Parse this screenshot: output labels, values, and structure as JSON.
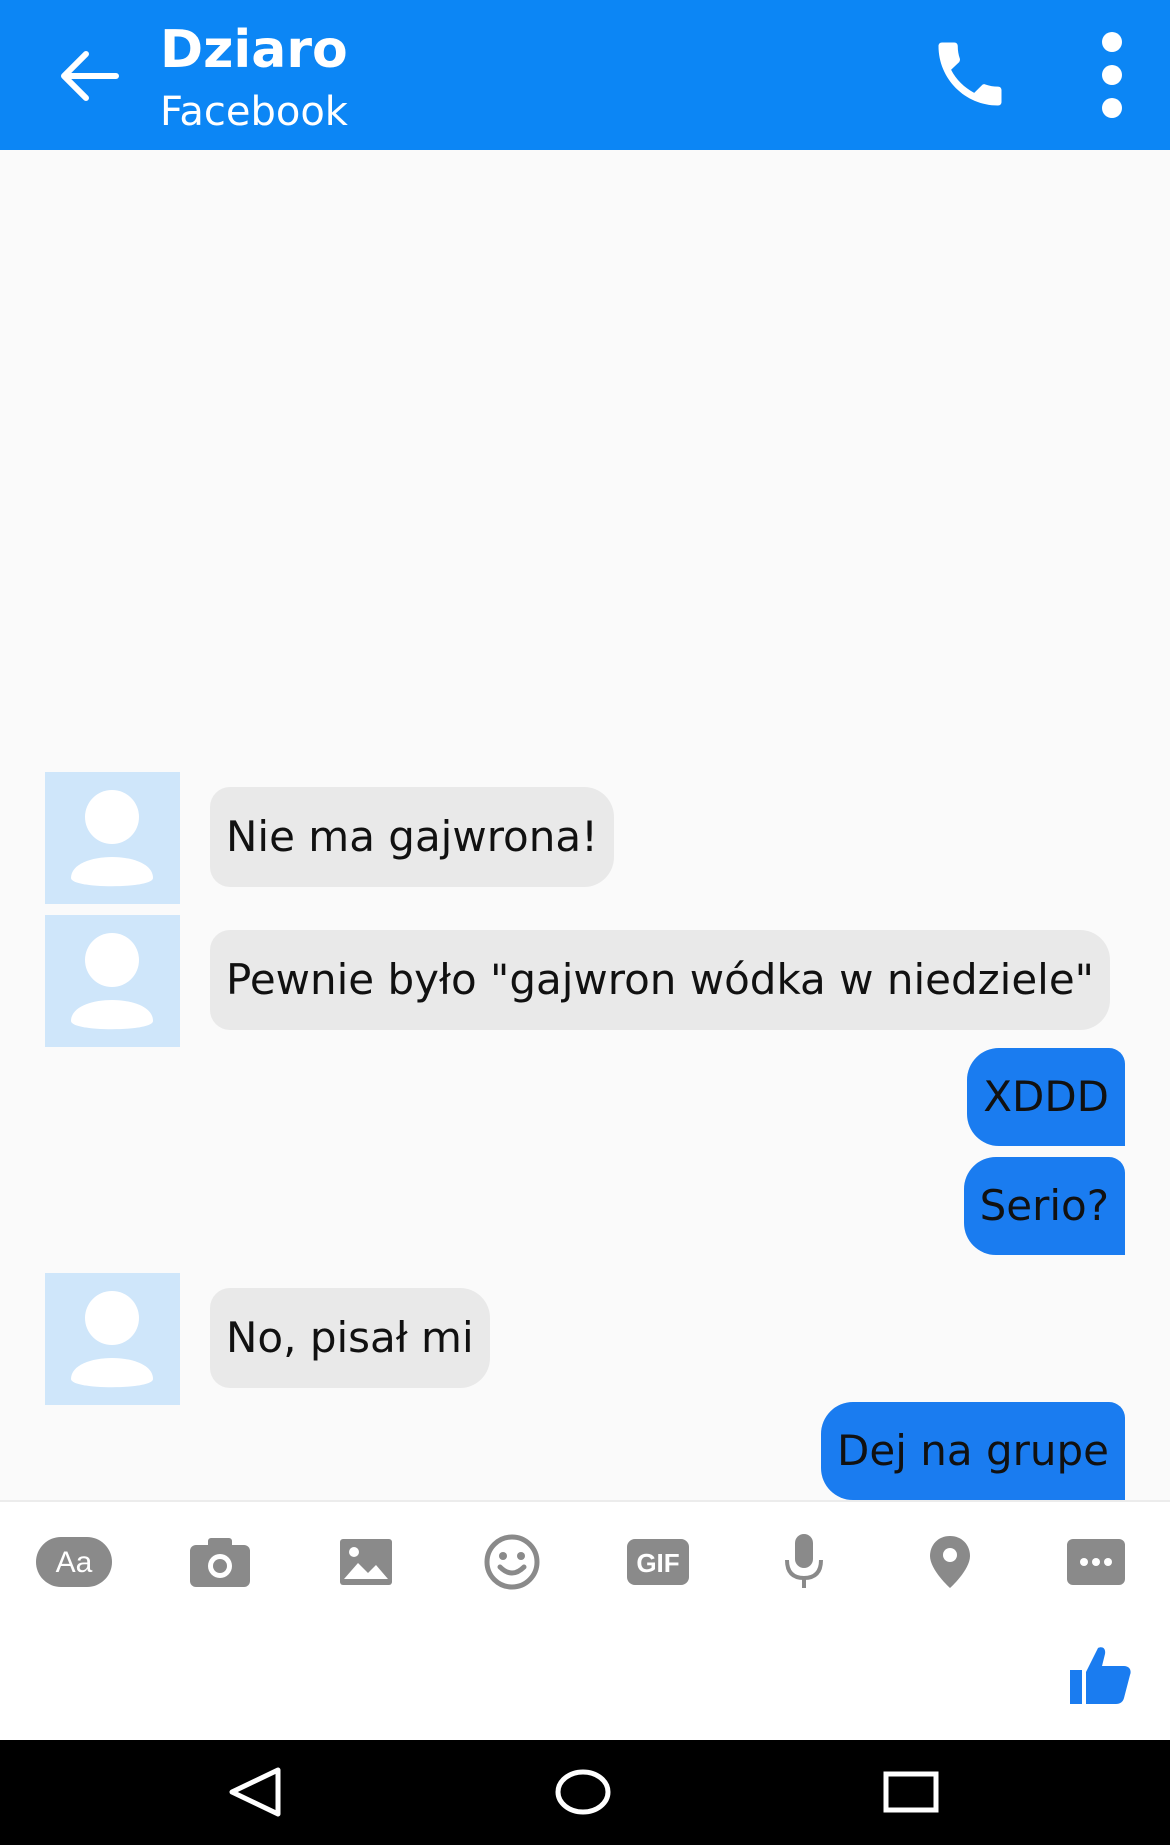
{
  "header": {
    "contact_name": "Dziaro",
    "subtitle": "Facebook",
    "icons": [
      "back-arrow-icon",
      "phone-icon",
      "more-vertical-icon"
    ]
  },
  "messages": [
    {
      "direction": "incoming",
      "text": "Nie ma gajwrona!"
    },
    {
      "direction": "incoming",
      "text": "Pewnie było \"gajwron wódka w niedziele\""
    },
    {
      "direction": "outgoing",
      "text": "XDDD"
    },
    {
      "direction": "outgoing",
      "text": "Serio?"
    },
    {
      "direction": "incoming",
      "text": "No, pisał mi"
    },
    {
      "direction": "outgoing",
      "text": "Dej na grupe"
    }
  ],
  "toolbar": {
    "aa_label": "Aa",
    "gif_label": "GIF",
    "icons": [
      "text-format-icon",
      "camera-icon",
      "gallery-icon",
      "emoji-icon",
      "gif-icon",
      "microphone-icon",
      "location-pin-icon",
      "more-horizontal-icon"
    ]
  },
  "composer": {
    "icons": [
      "thumbs-up-icon"
    ]
  },
  "system_nav": {
    "icons": [
      "back-triangle-icon",
      "home-circle-icon",
      "recents-square-icon"
    ]
  },
  "colors": {
    "header_blue": "#0c86f5",
    "outgoing_bubble": "#1a7cf0",
    "incoming_bubble": "#e9e9e9",
    "avatar_bg": "#cfe6fa",
    "toolbar_icon_gray": "#8a8a8a",
    "like_blue": "#1a7cf0"
  }
}
